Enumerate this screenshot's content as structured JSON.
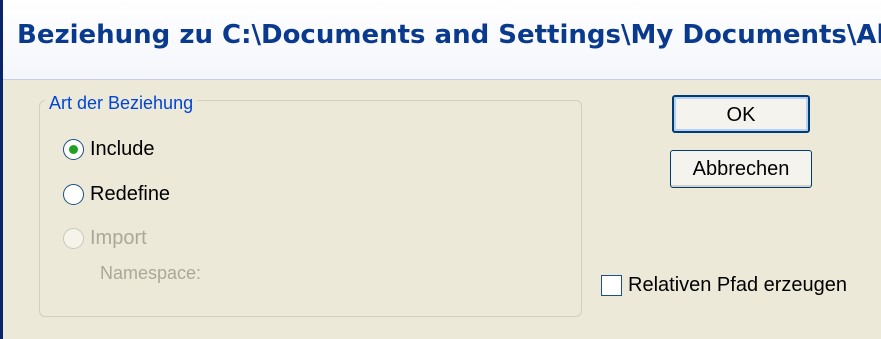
{
  "window": {
    "title": "Beziehung zu C:\\Documents and Settings\\My Documents\\Altova\\Sch..."
  },
  "group": {
    "legend": "Art der Beziehung",
    "options": [
      {
        "label": "Include",
        "selected": true,
        "enabled": true
      },
      {
        "label": "Redefine",
        "selected": false,
        "enabled": true
      },
      {
        "label": "Import",
        "selected": false,
        "enabled": false
      }
    ],
    "namespace_label": "Namespace:"
  },
  "buttons": {
    "ok_label": "OK",
    "cancel_label": "Abbrechen"
  },
  "checkbox": {
    "label": "Relativen Pfad erzeugen",
    "checked": false
  },
  "colors": {
    "title": "#0a3a8e",
    "legend": "#0046d5",
    "radio_dot": "#21a121",
    "disabled_text": "#aca899",
    "dialog_bg": "#ece9d8"
  }
}
